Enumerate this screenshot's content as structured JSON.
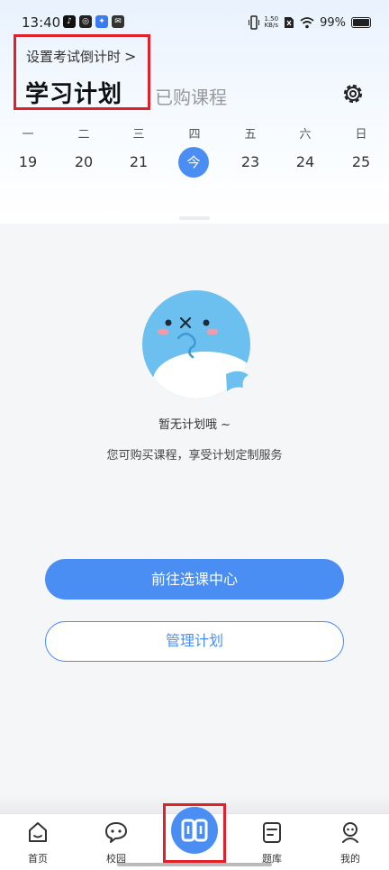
{
  "status_bar": {
    "time": "13:40",
    "net_speed_value": "1.50",
    "net_speed_unit": "KB/s",
    "battery": "99%"
  },
  "header": {
    "countdown_label": "设置考试倒计时",
    "tab_active": "学习计划",
    "tab_inactive": "已购课程",
    "settings_icon": "gear-icon"
  },
  "week": {
    "days": [
      {
        "name": "一",
        "date": "19",
        "today": false
      },
      {
        "name": "二",
        "date": "20",
        "today": false
      },
      {
        "name": "三",
        "date": "21",
        "today": false
      },
      {
        "name": "四",
        "date": "今",
        "today": true
      },
      {
        "name": "五",
        "date": "23",
        "today": false
      },
      {
        "name": "六",
        "date": "24",
        "today": false
      },
      {
        "name": "日",
        "date": "25",
        "today": false
      }
    ]
  },
  "empty_state": {
    "title": "暂无计划哦 ~",
    "subtitle": "您可购买课程，享受计划定制服务",
    "primary_button": "前往选课中心",
    "secondary_button": "管理计划"
  },
  "tabbar": {
    "items": [
      {
        "label": "首页",
        "icon": "home-icon"
      },
      {
        "label": "校园",
        "icon": "chat-bubble-icon"
      },
      {
        "label": "",
        "icon": "study-plan-icon"
      },
      {
        "label": "题库",
        "icon": "document-icon"
      },
      {
        "label": "我的",
        "icon": "profile-icon"
      }
    ]
  },
  "colors": {
    "accent": "#4a8ef4",
    "highlight_box": "#e0202a"
  }
}
